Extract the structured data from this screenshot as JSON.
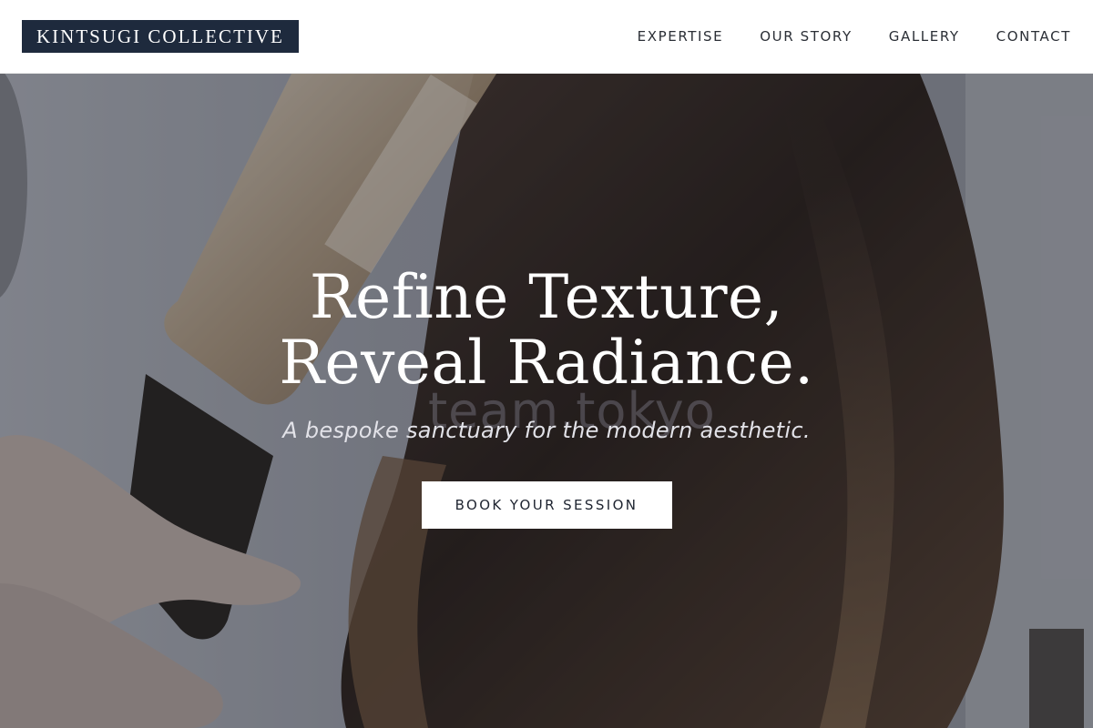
{
  "brand": {
    "name": "KINTSUGI COLLECTIVE",
    "bg_color": "#1e2a3d"
  },
  "nav": {
    "items": [
      {
        "label": "EXPERTISE"
      },
      {
        "label": "OUR STORY"
      },
      {
        "label": "GALLERY"
      },
      {
        "label": "CONTACT"
      }
    ]
  },
  "hero": {
    "headline": "Refine Texture, Reveal Radiance.",
    "tagline": "A bespoke sanctuary for the modern aesthetic.",
    "cta_label": "BOOK YOUR SESSION",
    "watermark": "team.tokyo",
    "image": "hair-styling-curling-iron-photo"
  }
}
